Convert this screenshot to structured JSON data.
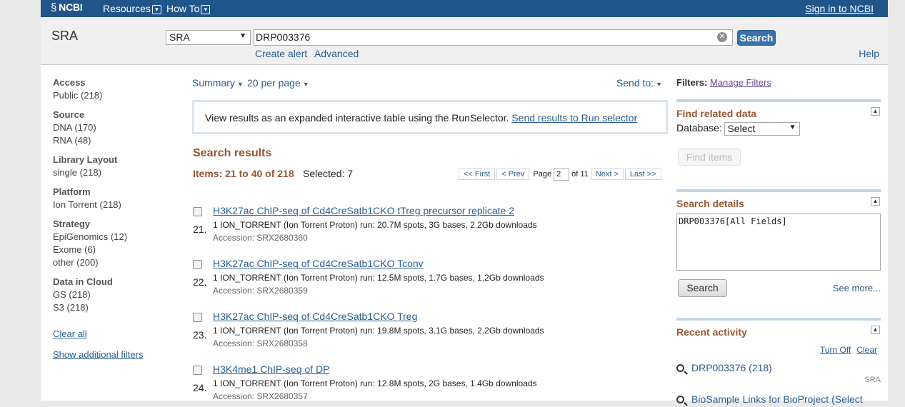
{
  "header": {
    "logo": "NCBI",
    "menus": [
      "Resources",
      "How To"
    ],
    "signin": "Sign in to NCBI"
  },
  "search": {
    "db_title": "SRA",
    "db_selected": "SRA",
    "term": "DRP003376",
    "button": "Search",
    "create_alert": "Create alert",
    "advanced": "Advanced",
    "help": "Help"
  },
  "facets": {
    "groups": [
      {
        "title": "Access",
        "items": [
          "Public (218)"
        ]
      },
      {
        "title": "Source",
        "items": [
          "DNA (170)",
          "RNA (48)"
        ]
      },
      {
        "title": "Library Layout",
        "items": [
          "single (218)"
        ]
      },
      {
        "title": "Platform",
        "items": [
          "Ion Torrent (218)"
        ]
      },
      {
        "title": "Strategy",
        "items": [
          "EpiGenomics (12)",
          "Exome (6)",
          "other (200)"
        ]
      },
      {
        "title": "Data in Cloud",
        "items": [
          "GS (218)",
          "S3 (218)"
        ]
      }
    ],
    "clear_all": "Clear all",
    "show_more": "Show additional filters"
  },
  "toolbar": {
    "summary": "Summary",
    "per_page": "20 per page",
    "send_to": "Send to:"
  },
  "banner": {
    "text": "View results as an expanded interactive table using the RunSelector.",
    "link": "Send results to Run selector"
  },
  "results": {
    "title": "Search results",
    "items_label": "Items: 21 to 40 of 218",
    "selected": "Selected: 7",
    "pager": {
      "first": "<< First",
      "prev": "< Prev",
      "page_label": "Page",
      "page": "2",
      "of": "of 11",
      "next": "Next >",
      "last": "Last >>"
    },
    "list": [
      {
        "num": "21.",
        "title": "H3K27ac ChIP-seq of Cd4CreSatb1CKO tTreg precursor replicate 2",
        "desc": "1 ION_TORRENT (Ion Torrent Proton) run: 20.7M spots, 3G bases, 2.2Gb downloads",
        "acc": "Accession: SRX2680360"
      },
      {
        "num": "22.",
        "title": "H3K27ac ChIP-seq of Cd4CreSatb1CKO Tconv",
        "desc": "1 ION_TORRENT (Ion Torrent Proton) run: 12.5M spots, 1.7G bases, 1.2Gb downloads",
        "acc": "Accession: SRX2680359"
      },
      {
        "num": "23.",
        "title": "H3K27ac ChIP-seq of Cd4CreSatb1CKO Treg",
        "desc": "1 ION_TORRENT (Ion Torrent Proton) run: 19.8M spots, 3.1G bases, 2.2Gb downloads",
        "acc": "Accession: SRX2680358"
      },
      {
        "num": "24.",
        "title": "H3K4me1 ChIP-seq of DP",
        "desc": "1 ION_TORRENT (Ion Torrent Proton) run: 12.8M spots, 2G bases, 1.4Gb downloads",
        "acc": "Accession: SRX2680357"
      }
    ]
  },
  "right": {
    "filters_label": "Filters:",
    "manage_filters": "Manage Filters",
    "find_related": {
      "title": "Find related data",
      "db_label": "Database:",
      "db_value": "Select",
      "button": "Find items"
    },
    "details": {
      "title": "Search details",
      "query": "DRP003376[All Fields]",
      "button": "Search",
      "see_more": "See more..."
    },
    "recent": {
      "title": "Recent activity",
      "turn_off": "Turn Off",
      "clear": "Clear",
      "items": [
        {
          "text": "DRP003376 (218)",
          "tag": "SRA"
        },
        {
          "text": "BioSample Links for BioProject (Select",
          "tag": ""
        }
      ]
    }
  }
}
